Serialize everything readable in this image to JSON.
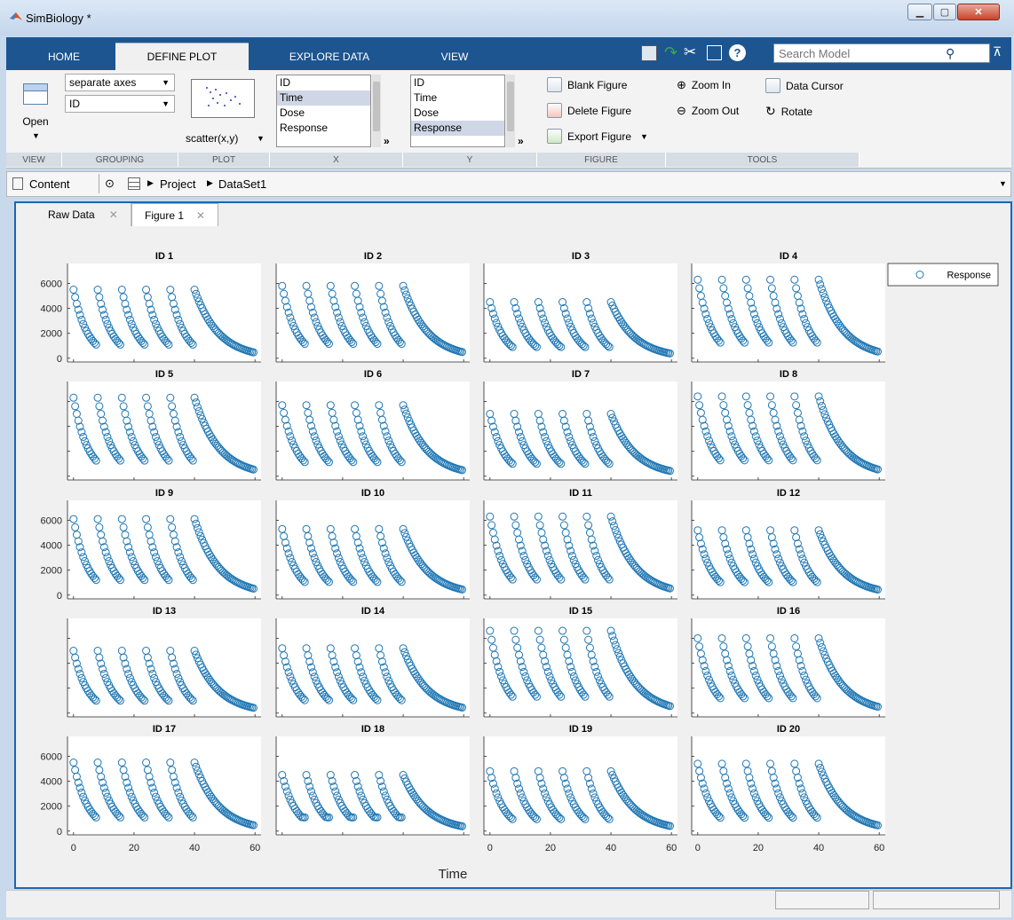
{
  "window": {
    "title": "SimBiology *"
  },
  "tabs": [
    {
      "label": "HOME"
    },
    {
      "label": "DEFINE PLOT"
    },
    {
      "label": "EXPLORE DATA"
    },
    {
      "label": "VIEW"
    }
  ],
  "search": {
    "placeholder": "Search Model"
  },
  "ribbon": {
    "view": {
      "open_label": "Open",
      "section": "VIEW"
    },
    "grouping": {
      "combo1": "separate axes",
      "combo2": "ID",
      "section": "GROUPING"
    },
    "plot": {
      "type_label": "scatter(x,y)",
      "section": "PLOT"
    },
    "x": {
      "items": [
        "ID",
        "Time",
        "Dose",
        "Response"
      ],
      "selected": "Time",
      "section": "X"
    },
    "y": {
      "items": [
        "ID",
        "Time",
        "Dose",
        "Response"
      ],
      "selected": "Response",
      "section": "Y"
    },
    "figure": {
      "blank": "Blank Figure",
      "delete": "Delete Figure",
      "export": "Export Figure",
      "section": "FIGURE"
    },
    "tools": {
      "zoom_in": "Zoom In",
      "zoom_out": "Zoom Out",
      "data_cursor": "Data Cursor",
      "rotate": "Rotate",
      "section": "TOOLS"
    },
    "more_glyph": "»"
  },
  "address": {
    "content_label": "Content",
    "crumbs": [
      "Project",
      "DataSet1"
    ]
  },
  "doc_tabs": [
    {
      "label": "Raw Data",
      "active": false
    },
    {
      "label": "Figure 1",
      "active": true
    }
  ],
  "colors": {
    "marker": "#1f77b4",
    "tab_bar": "#1c5590",
    "accent_blue": "#1f65b2"
  },
  "chart_data": {
    "type": "scatter",
    "layout": "5 rows x 4 columns grid of subplots, shared axes",
    "xlabel": "Time",
    "ylabel": "",
    "xlim": [
      -2,
      62
    ],
    "ylim": [
      -300,
      7600
    ],
    "xticks": [
      0,
      20,
      40,
      60
    ],
    "yticks": [
      0,
      2000,
      4000,
      6000
    ],
    "grid": false,
    "legend": {
      "entries": [
        "Response"
      ],
      "position": "right",
      "marker": "circle"
    },
    "x_tick_label_panels": [
      16,
      18,
      19
    ],
    "y_tick_label_panels": [
      0,
      8,
      16
    ],
    "dose_times": [
      0,
      8,
      16,
      24,
      32,
      40
    ],
    "elimination_rate": 0.12,
    "tail_end_time": 60,
    "samples_per_dose_interval": 15,
    "series": [
      {
        "name": "ID 1",
        "peak": 5500,
        "trough": 500
      },
      {
        "name": "ID 2",
        "peak": 5800,
        "trough": 500
      },
      {
        "name": "ID 3",
        "peak": 4500,
        "trough": 600
      },
      {
        "name": "ID 4",
        "peak": 6300,
        "trough": 700
      },
      {
        "name": "ID 5",
        "peak": 6300,
        "trough": 700
      },
      {
        "name": "ID 6",
        "peak": 5700,
        "trough": 600
      },
      {
        "name": "ID 7",
        "peak": 5000,
        "trough": 700
      },
      {
        "name": "ID 8",
        "peak": 6400,
        "trough": 700
      },
      {
        "name": "ID 9",
        "peak": 6100,
        "trough": 700
      },
      {
        "name": "ID 10",
        "peak": 5300,
        "trough": 600
      },
      {
        "name": "ID 11",
        "peak": 6300,
        "trough": 600
      },
      {
        "name": "ID 12",
        "peak": 5200,
        "trough": 600
      },
      {
        "name": "ID 13",
        "peak": 5000,
        "trough": 700
      },
      {
        "name": "ID 14",
        "peak": 5200,
        "trough": 700
      },
      {
        "name": "ID 15",
        "peak": 6600,
        "trough": 700
      },
      {
        "name": "ID 16",
        "peak": 6000,
        "trough": 700
      },
      {
        "name": "ID 17",
        "peak": 5500,
        "trough": 500
      },
      {
        "name": "ID 18",
        "peak": 4500,
        "trough": 1100
      },
      {
        "name": "ID 19",
        "peak": 4800,
        "trough": 700
      },
      {
        "name": "ID 20",
        "peak": 5400,
        "trough": 700
      }
    ]
  }
}
